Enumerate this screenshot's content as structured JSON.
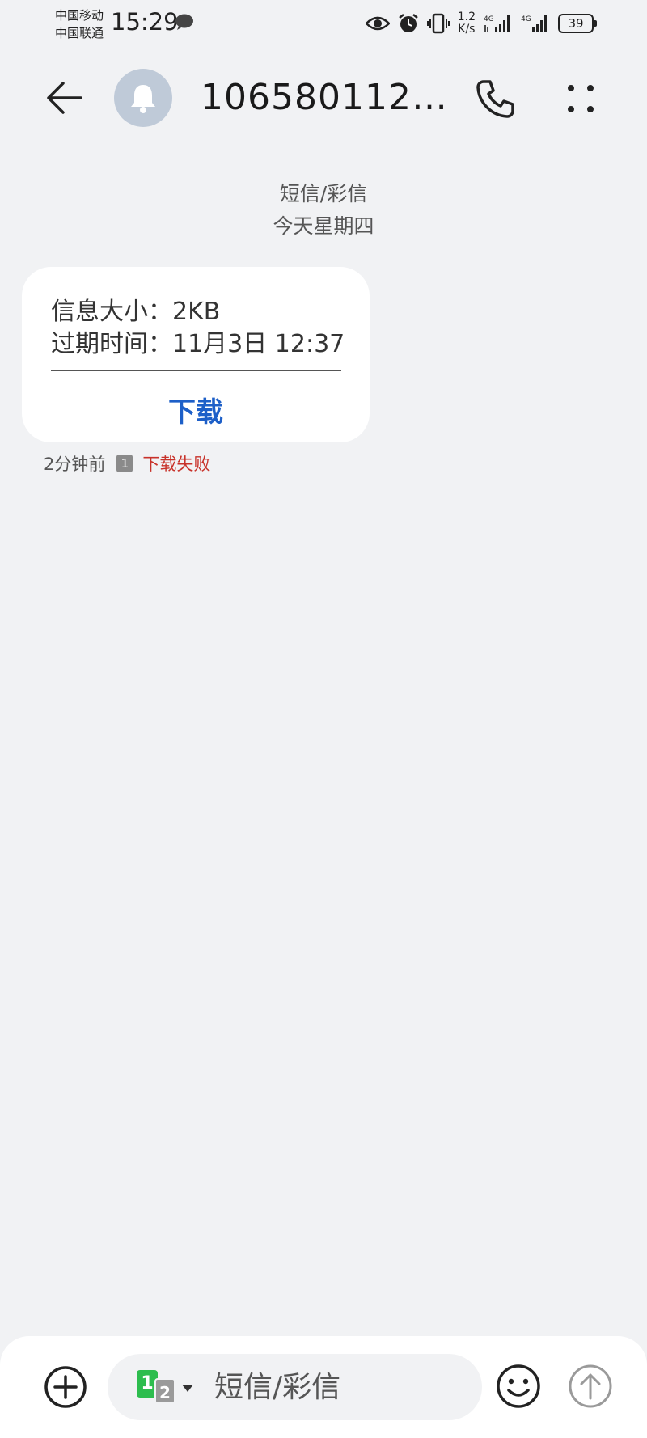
{
  "status_bar": {
    "carrier_1": "中国移动",
    "carrier_2": "中国联通",
    "time": "15:29",
    "net_speed_value": "1.2",
    "net_speed_unit": "K/s",
    "signal_1_label": "4G",
    "signal_2_label": "4G",
    "battery": "39",
    "battery_level_percent": 39
  },
  "header": {
    "contact_name": "1065801120…",
    "avatar_icon": "bell-icon",
    "back_icon": "arrow-left-icon",
    "call_icon": "phone-icon",
    "more_icon": "more-dots-icon"
  },
  "conversation": {
    "type_label": "短信/彩信",
    "date_label": "今天星期四"
  },
  "message": {
    "size_label": "信息大小：",
    "size_value": "2KB",
    "expiry_label": "过期时间：",
    "expiry_value": "11月3日 12:37",
    "download_label": "下载",
    "time_ago": "2分钟前",
    "sim_badge": "1",
    "status_text": "下载失败"
  },
  "composer": {
    "sim_primary": "1",
    "sim_secondary": "2",
    "placeholder": "短信/彩信",
    "add_icon": "plus-circle-icon",
    "emoji_icon": "smiley-icon",
    "send_icon": "send-arrow-icon"
  },
  "colors": {
    "background": "#f1f2f4",
    "accent_blue": "#1d5fc8",
    "error_red": "#c8322a",
    "avatar_bg": "#bfcad8",
    "sim1_green": "#2dbd4e"
  }
}
